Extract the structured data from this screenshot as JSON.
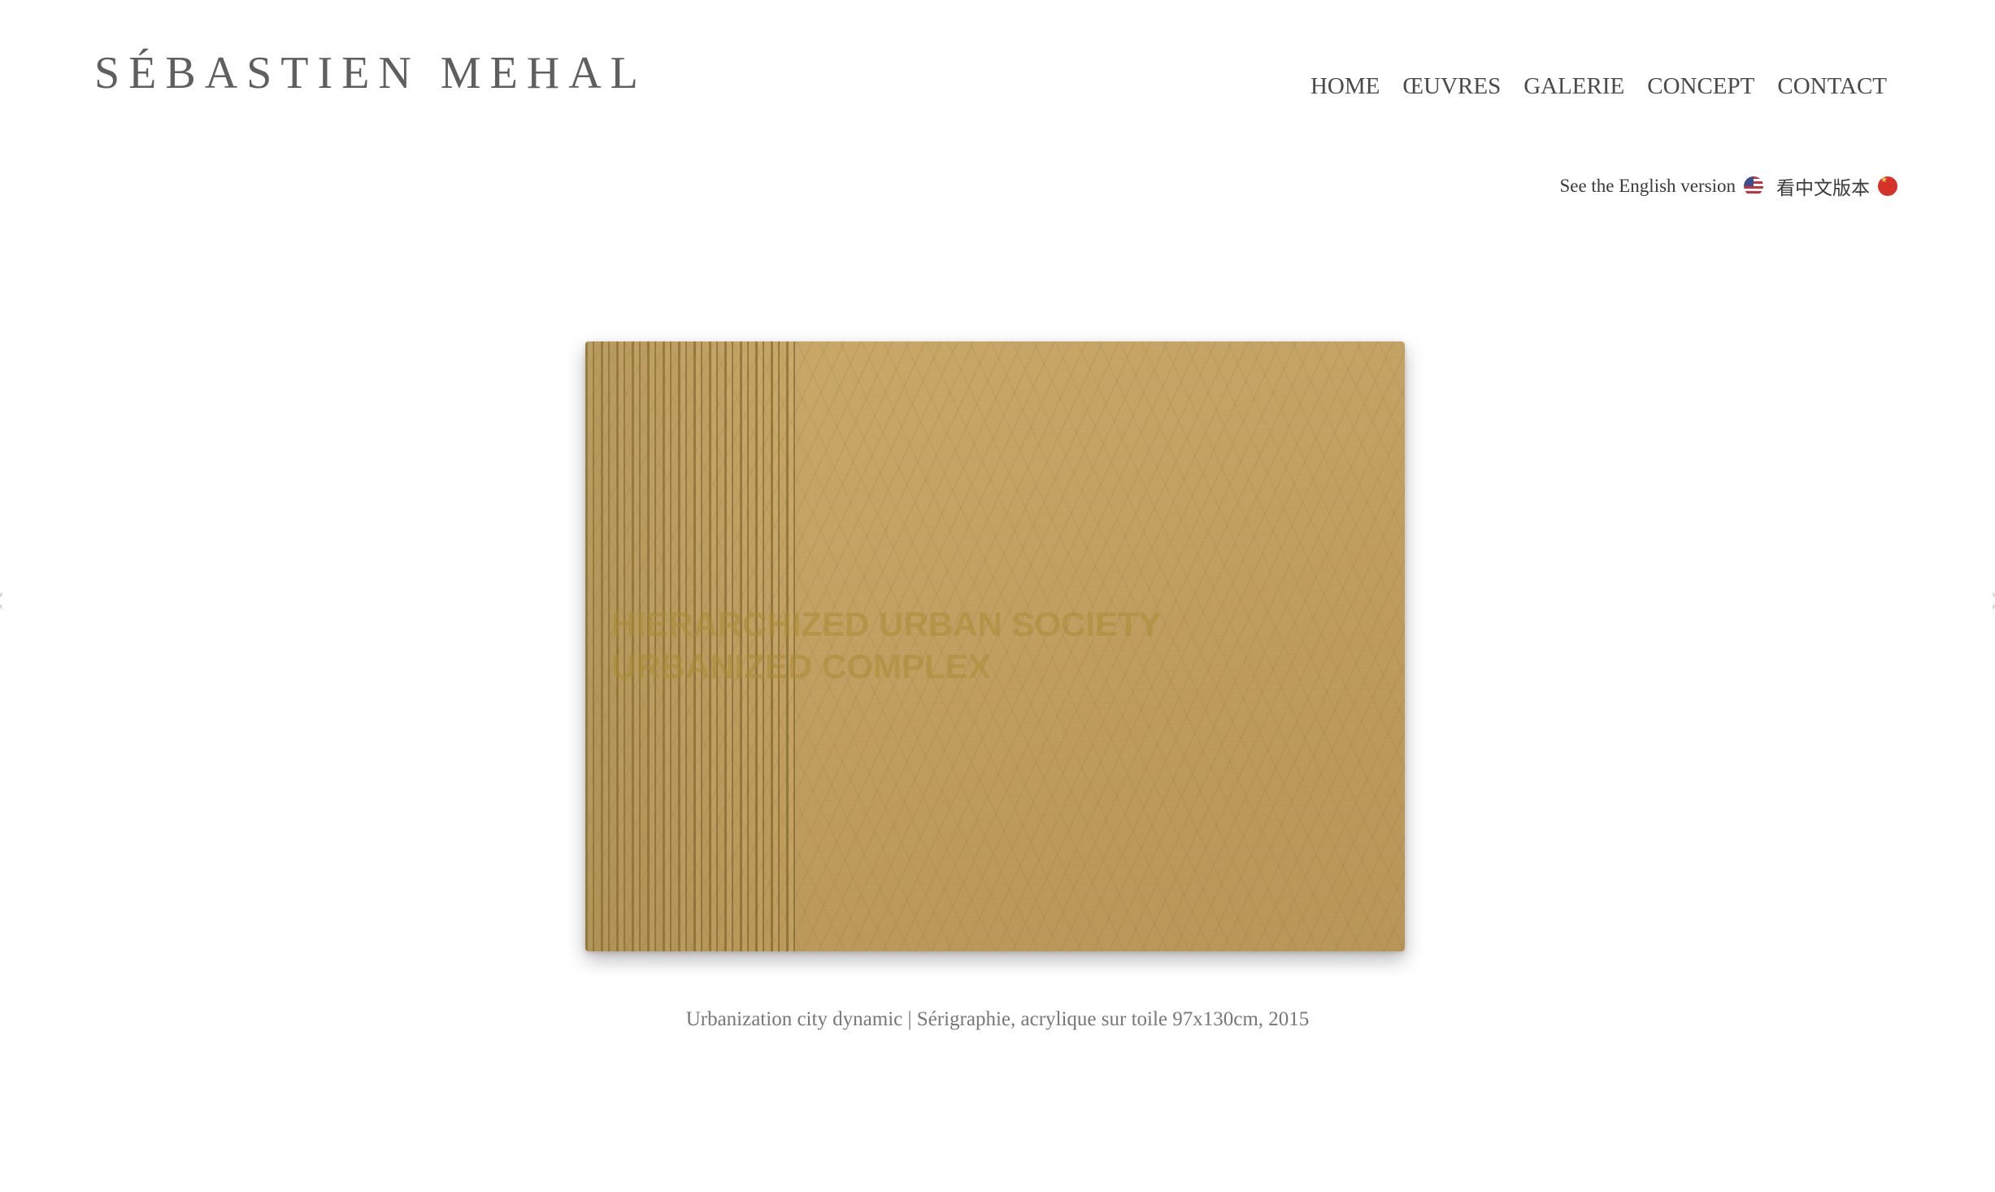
{
  "header": {
    "logo": "SÉBASTIEN MEHAL",
    "nav": [
      "HOME",
      "ŒUVRES",
      "GALERIE",
      "CONCEPT",
      "CONTACT"
    ]
  },
  "language": {
    "english_link": "See the English version",
    "chinese_link": "看中文版本"
  },
  "slider": {
    "artwork_text_line1": "HIERARCHIZED URBAN SOCIETY",
    "artwork_text_line2": "URBANIZED COMPLEX",
    "caption": "Urbanization city dynamic | Sérigraphie, acrylique sur toile 97x130cm, 2015",
    "prev_icon": "chevron-left-icon",
    "next_icon": "chevron-right-icon"
  },
  "colors": {
    "text_primary": "#5f5f5f",
    "caption": "#777777",
    "artwork_gold": "#c3a163"
  }
}
